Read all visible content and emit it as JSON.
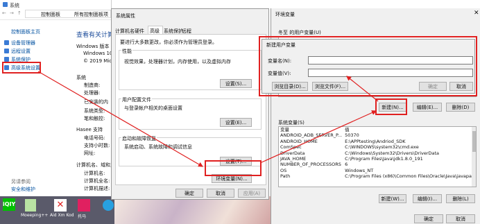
{
  "system_window": {
    "title": "系统",
    "address": [
      "控制面板",
      "所有控制面板项",
      "系统"
    ],
    "left_nav": {
      "home": "控制面板主页",
      "items": [
        "设备管理器",
        "远程设置",
        "系统保护",
        "高级系统设置"
      ],
      "see_also": "另请参阅",
      "security": "安全和维护"
    },
    "main": {
      "heading": "查看有关计算",
      "edition_label": "Windows 版本",
      "edition": [
        "Windows 10 ",
        "© 2019 Micr"
      ],
      "system_label": "系统",
      "system_rows": [
        "制造商:",
        "处理器:",
        "已安装的内",
        "系统类型:",
        "笔和触控:"
      ],
      "support_label": "Hasee 支持",
      "support_rows": [
        "电话号码:",
        "支持小时数:",
        "网址:"
      ],
      "computer_label": "计算机名、域和工",
      "computer_rows": [
        "计算机名:",
        "计算机全名:",
        "计算机描述:"
      ]
    }
  },
  "sysprops": {
    "title": "系统属性",
    "tabs": [
      "计算机名",
      "硬件",
      "高级",
      "系统保护",
      "远程"
    ],
    "admin_note": "要进行大多数更改，你必须作为管理员登录。",
    "perf_label": "性能",
    "perf_desc": "视觉效果，处理器计划，内存使用，以及虚拟内存",
    "settings_btn": "设置(S)...",
    "profile_label": "用户配置文件",
    "profile_desc": "与登录帐户相关的桌面设置",
    "settings_btn2": "设置(E)...",
    "startup_label": "启动和故障恢复",
    "startup_desc": "系统启动、系统故障和调试信息",
    "settings_btn3": "设置(T)...",
    "env_btn": "环境变量(N)...",
    "ok": "确定",
    "cancel": "取消",
    "apply": "应用(A)"
  },
  "env_window": {
    "title": "环境变量",
    "user_vars_label": "冬至 的用户变量(U)",
    "new_btn": "新建(N)...",
    "edit_btn": "编辑(E)...",
    "delete_btn": "删除(D)",
    "sys_vars_label": "系统变量(S)",
    "columns": [
      "变量",
      "值"
    ],
    "sys_vars": [
      [
        "ANDROID_ADB_SERVER_P...",
        "50370"
      ],
      [
        "ANDROID_HOME",
        "E:\\APPtesting\\Andriod_SDK"
      ],
      [
        "ComSpec",
        "C:\\WINDOWS\\system32\\cmd.exe"
      ],
      [
        "DriverData",
        "C:\\Windows\\System32\\Drivers\\DriverData"
      ],
      [
        "JAVA_HOME",
        "C:\\Program Files\\Java\\jdk1.8.0_191"
      ],
      [
        "NUMBER_OF_PROCESSORS",
        "6"
      ],
      [
        "OS",
        "Windows_NT"
      ],
      [
        "Path",
        "C:\\Program Files (x86)\\Common Files\\Oracle\\Java\\javapath;C:\\W..."
      ]
    ],
    "new_btn2": "新建(W)...",
    "edit_btn2": "编辑(I)...",
    "delete_btn2": "删除(L)",
    "ok": "确定",
    "cancel": "取消"
  },
  "new_var_dialog": {
    "title": "新建用户变量",
    "name_label": "变量名(N):",
    "value_label": "变量值(V):",
    "browse_dir": "浏览目录(D)...",
    "browse_file": "浏览文件(F)...",
    "ok": "确定",
    "cancel": "取消"
  },
  "desktop": {
    "icons": [
      "",
      "Moeeping++",
      "Aid Xm Kod",
      "托马"
    ]
  },
  "colors": {
    "highlight": "#e02020",
    "accent": "#0063b1"
  }
}
